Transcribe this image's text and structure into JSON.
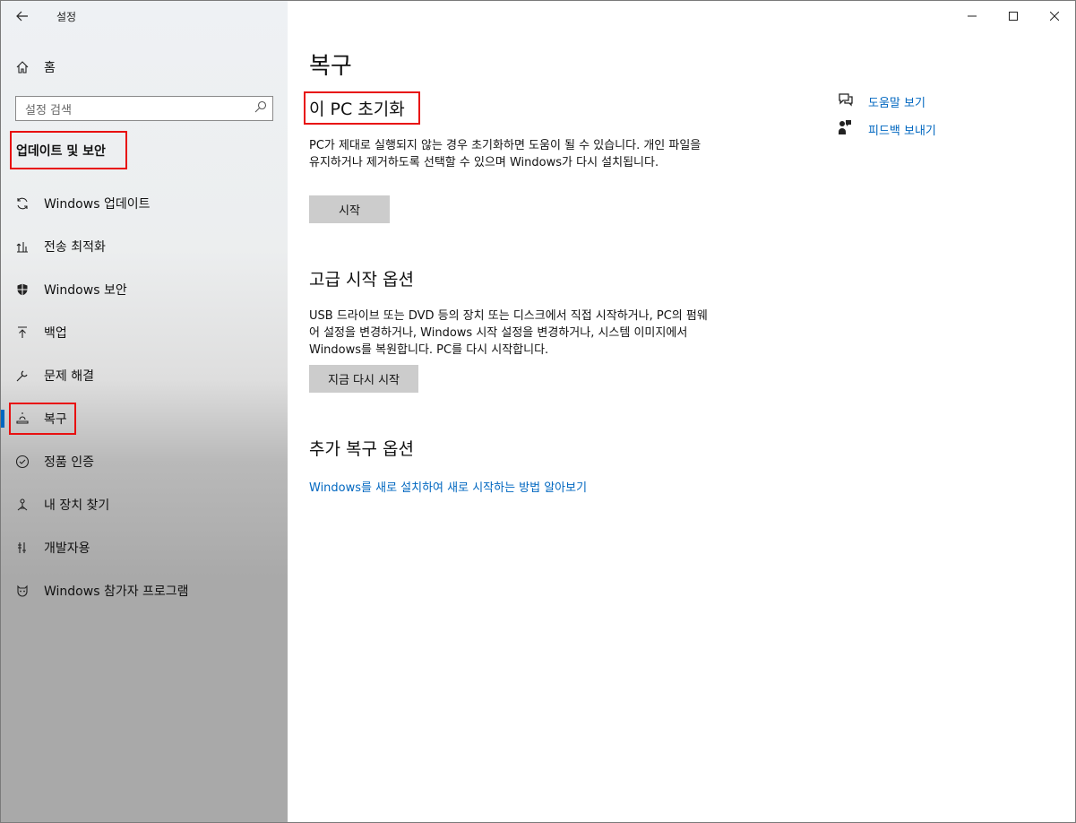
{
  "window": {
    "app_title": "설정",
    "controls": {
      "minimize": "—",
      "maximize": "☐",
      "close": "✕"
    }
  },
  "sidebar": {
    "home_label": "홈",
    "search_placeholder": "설정 검색",
    "section_title": "업데이트 및 보안",
    "items": [
      {
        "label": "Windows 업데이트",
        "icon": "sync-icon"
      },
      {
        "label": "전송 최적화",
        "icon": "delivery-optimization-icon"
      },
      {
        "label": "Windows 보안",
        "icon": "shield-icon"
      },
      {
        "label": "백업",
        "icon": "backup-icon"
      },
      {
        "label": "문제 해결",
        "icon": "wrench-icon"
      },
      {
        "label": "복구",
        "icon": "recovery-icon"
      },
      {
        "label": "정품 인증",
        "icon": "activation-icon"
      },
      {
        "label": "내 장치 찾기",
        "icon": "find-device-icon"
      },
      {
        "label": "개발자용",
        "icon": "developer-icon"
      },
      {
        "label": "Windows 참가자 프로그램",
        "icon": "insider-icon"
      }
    ],
    "selected_index": 5
  },
  "main": {
    "page_title": "복구",
    "reset": {
      "heading": "이 PC 초기화",
      "description": "PC가 제대로 실행되지 않는 경우 초기화하면 도움이 될 수 있습니다. 개인 파일을 유지하거나 제거하도록 선택할 수 있으며 Windows가 다시 설치됩니다.",
      "button": "시작"
    },
    "advanced": {
      "heading": "고급 시작 옵션",
      "description": "USB 드라이브 또는 DVD 등의 장치 또는 디스크에서 직접 시작하거나, PC의 펌웨어 설정을 변경하거나, Windows 시작 설정을 변경하거나, 시스템 이미지에서 Windows를 복원합니다. PC를 다시 시작합니다.",
      "button": "지금 다시 시작"
    },
    "more": {
      "heading": "추가 복구 옵션",
      "link": "Windows를 새로 설치하여 새로 시작하는 방법 알아보기"
    }
  },
  "help": {
    "get_help": "도움말 보기",
    "feedback": "피드백 보내기"
  },
  "colors": {
    "accent": "#0067c0",
    "highlight_box": "#e81010",
    "button_bg": "#cccccc"
  }
}
